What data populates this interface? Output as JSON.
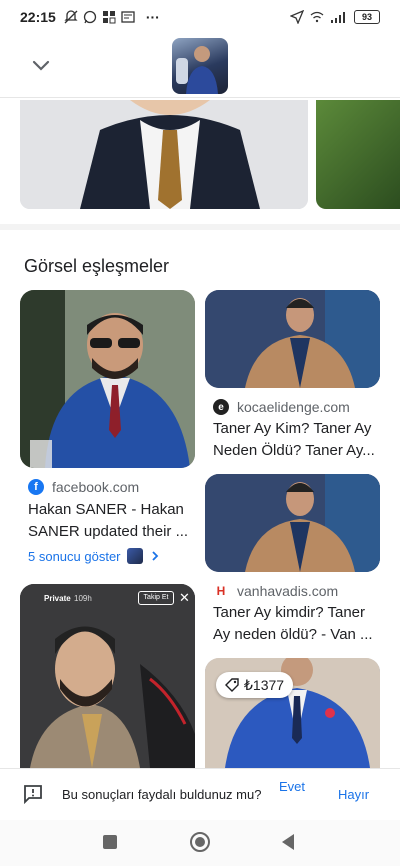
{
  "status_bar": {
    "time": "22:15",
    "dots": "···",
    "battery": "93"
  },
  "section": {
    "title": "Görsel eşleşmeler"
  },
  "cards": [
    {
      "source": "facebook.com",
      "title": "Hakan SANER - Hakan SANER updated their ..."
    },
    {
      "source": "kocaelidenge.com",
      "title": "Taner Ay Kim? Taner Ay Neden Öldü? Taner Ay..."
    },
    {
      "source": "vanhavadis.com",
      "title": "Taner Ay kimdir? Taner Ay neden öldü? - Van ..."
    }
  ],
  "more_results": {
    "label": "5 sonucu göster"
  },
  "story_overlay": {
    "user": "Private",
    "time": "109h",
    "follow": "Takip Et"
  },
  "price_chip": {
    "price": "₺1377"
  },
  "feedback": {
    "question": "Bu sonuçları faydalı buldunuz mu?",
    "yes": "Evet",
    "no": "Hayır"
  }
}
